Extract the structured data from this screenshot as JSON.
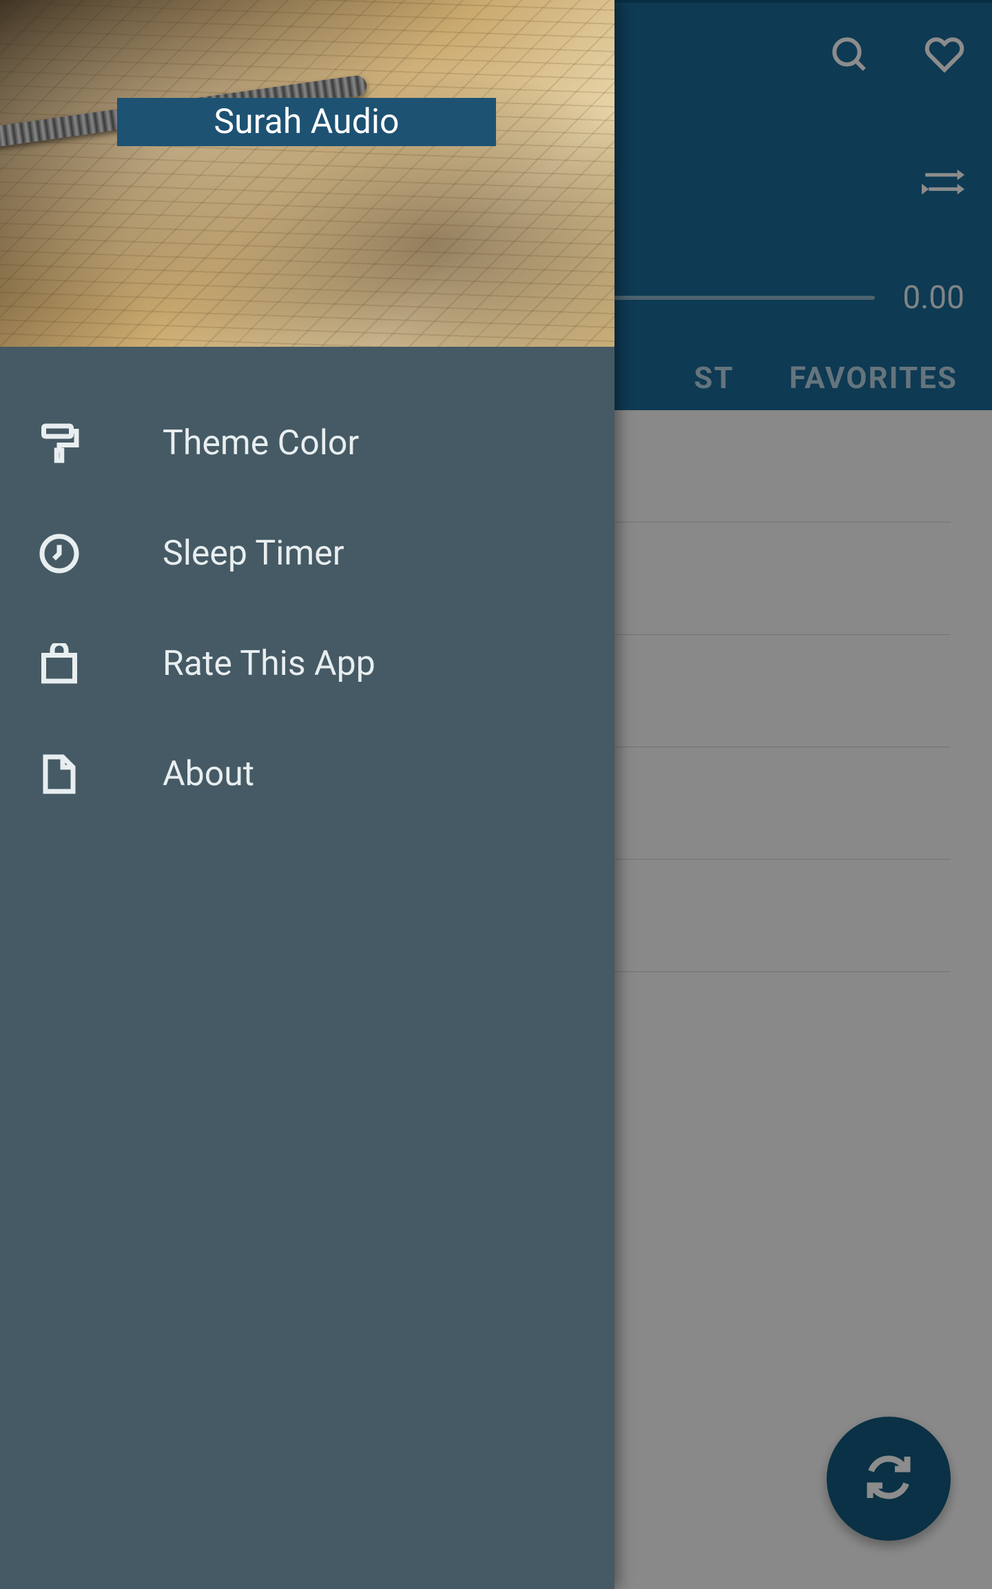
{
  "app": {
    "title": "Surah Audio"
  },
  "player": {
    "time": "0.00"
  },
  "tabs": {
    "list_suffix": "ST",
    "favorites": "FAVORITES"
  },
  "drawer": {
    "items": [
      {
        "label": "Theme Color",
        "icon": "paint-roller-icon"
      },
      {
        "label": "Sleep Timer",
        "icon": "clock-icon"
      },
      {
        "label": "Rate This App",
        "icon": "shopping-bag-icon"
      },
      {
        "label": "About",
        "icon": "file-icon"
      }
    ]
  }
}
